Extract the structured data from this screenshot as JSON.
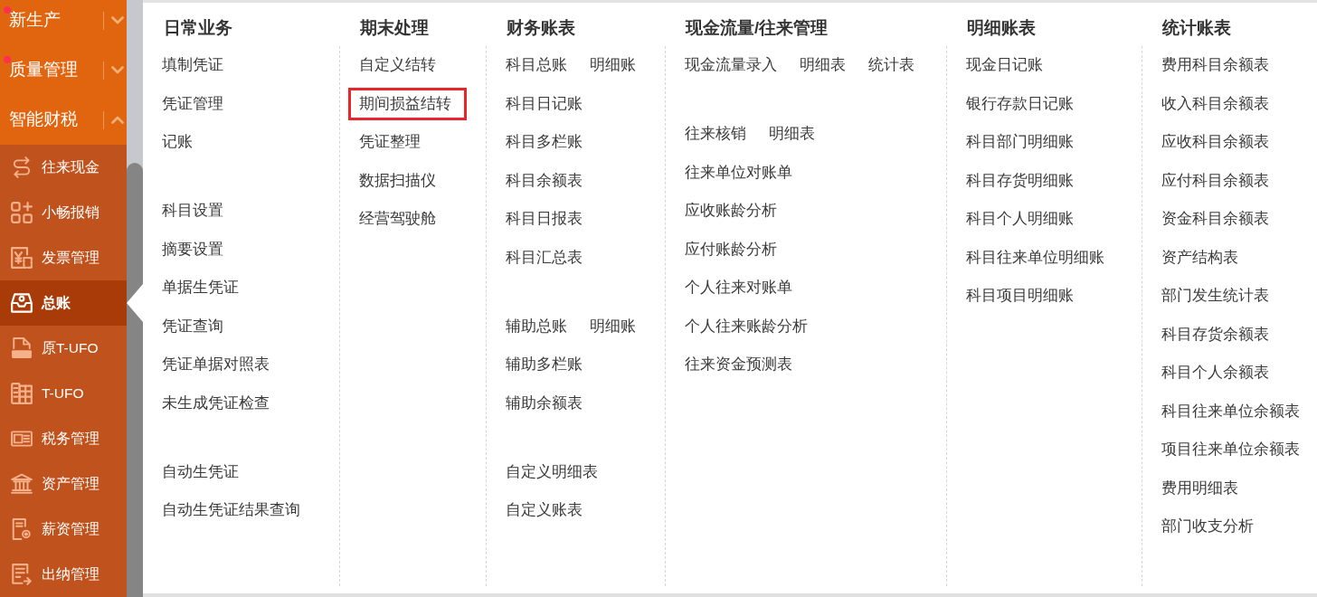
{
  "sidebar": {
    "items": [
      {
        "label": "新生产",
        "expanded": false,
        "has_update": true
      },
      {
        "label": "质量管理",
        "expanded": false,
        "has_update": true
      },
      {
        "label": "智能财税",
        "expanded": true,
        "has_update": false,
        "children": [
          {
            "label": "往来现金",
            "selected": false
          },
          {
            "label": "小畅报销",
            "selected": false
          },
          {
            "label": "发票管理",
            "selected": false
          },
          {
            "label": "总账",
            "selected": true
          },
          {
            "label": "原T-UFO",
            "selected": false
          },
          {
            "label": "T-UFO",
            "selected": false
          },
          {
            "label": "税务管理",
            "selected": false
          },
          {
            "label": "资产管理",
            "selected": false
          },
          {
            "label": "薪资管理",
            "selected": false
          },
          {
            "label": "出纳管理",
            "selected": false
          }
        ]
      }
    ]
  },
  "menu": {
    "columns": [
      {
        "title": "日常业务",
        "groups": [
          [
            [
              {
                "label": "填制凭证",
                "highlighted": false
              }
            ],
            [
              {
                "label": "凭证管理",
                "highlighted": false
              }
            ],
            [
              {
                "label": "记账",
                "highlighted": false
              }
            ]
          ],
          [
            [
              {
                "label": "科目设置",
                "highlighted": false
              }
            ],
            [
              {
                "label": "摘要设置",
                "highlighted": false
              }
            ],
            [
              {
                "label": "单据生凭证",
                "highlighted": false
              }
            ],
            [
              {
                "label": "凭证查询",
                "highlighted": false
              }
            ],
            [
              {
                "label": "凭证单据对照表",
                "highlighted": false
              }
            ],
            [
              {
                "label": "未生成凭证检查",
                "highlighted": false
              }
            ]
          ],
          [
            [
              {
                "label": "自动生凭证",
                "highlighted": false
              }
            ],
            [
              {
                "label": "自动生凭证结果查询",
                "highlighted": false
              }
            ]
          ]
        ]
      },
      {
        "title": "期末处理",
        "groups": [
          [
            [
              {
                "label": "自定义结转",
                "highlighted": false
              }
            ],
            [
              {
                "label": "期间损益结转",
                "highlighted": true
              }
            ],
            [
              {
                "label": "凭证整理",
                "highlighted": false
              }
            ],
            [
              {
                "label": "数据扫描仪",
                "highlighted": false
              }
            ],
            [
              {
                "label": "经营驾驶舱",
                "highlighted": false
              }
            ]
          ]
        ]
      },
      {
        "title": "财务账表",
        "groups": [
          [
            [
              {
                "label": "科目总账",
                "highlighted": false
              },
              {
                "label": "明细账",
                "highlighted": false
              }
            ],
            [
              {
                "label": "科目日记账",
                "highlighted": false
              }
            ],
            [
              {
                "label": "科目多栏账",
                "highlighted": false
              }
            ],
            [
              {
                "label": "科目余额表",
                "highlighted": false
              }
            ],
            [
              {
                "label": "科目日报表",
                "highlighted": false
              }
            ],
            [
              {
                "label": "科目汇总表",
                "highlighted": false
              }
            ]
          ],
          [
            [
              {
                "label": "辅助总账",
                "highlighted": false
              },
              {
                "label": "明细账",
                "highlighted": false
              }
            ],
            [
              {
                "label": "辅助多栏账",
                "highlighted": false
              }
            ],
            [
              {
                "label": "辅助余额表",
                "highlighted": false
              }
            ]
          ],
          [
            [
              {
                "label": "自定义明细表",
                "highlighted": false
              }
            ],
            [
              {
                "label": "自定义账表",
                "highlighted": false
              }
            ]
          ]
        ]
      },
      {
        "title": "现金流量/往来管理",
        "groups": [
          [
            [
              {
                "label": "现金流量录入",
                "highlighted": false
              },
              {
                "label": "明细表",
                "highlighted": false
              },
              {
                "label": "统计表",
                "highlighted": false
              }
            ]
          ],
          [
            [
              {
                "label": "往来核销",
                "highlighted": false
              },
              {
                "label": "明细表",
                "highlighted": false
              }
            ],
            [
              {
                "label": "往来单位对账单",
                "highlighted": false
              }
            ],
            [
              {
                "label": "应收账龄分析",
                "highlighted": false
              }
            ],
            [
              {
                "label": "应付账龄分析",
                "highlighted": false
              }
            ],
            [
              {
                "label": "个人往来对账单",
                "highlighted": false
              }
            ],
            [
              {
                "label": "个人往来账龄分析",
                "highlighted": false
              }
            ],
            [
              {
                "label": "往来资金预测表",
                "highlighted": false
              }
            ]
          ]
        ]
      },
      {
        "title": "明细账表",
        "groups": [
          [
            [
              {
                "label": "现金日记账",
                "highlighted": false
              }
            ],
            [
              {
                "label": "银行存款日记账",
                "highlighted": false
              }
            ],
            [
              {
                "label": "科目部门明细账",
                "highlighted": false
              }
            ],
            [
              {
                "label": "科目存货明细账",
                "highlighted": false
              }
            ],
            [
              {
                "label": "科目个人明细账",
                "highlighted": false
              }
            ],
            [
              {
                "label": "科目往来单位明细账",
                "highlighted": false
              }
            ],
            [
              {
                "label": "科目项目明细账",
                "highlighted": false
              }
            ]
          ]
        ]
      },
      {
        "title": "统计账表",
        "groups": [
          [
            [
              {
                "label": "费用科目余额表",
                "highlighted": false
              }
            ],
            [
              {
                "label": "收入科目余额表",
                "highlighted": false
              }
            ],
            [
              {
                "label": "应收科目余额表",
                "highlighted": false
              }
            ],
            [
              {
                "label": "应付科目余额表",
                "highlighted": false
              }
            ],
            [
              {
                "label": "资金科目余额表",
                "highlighted": false
              }
            ],
            [
              {
                "label": "资产结构表",
                "highlighted": false
              }
            ],
            [
              {
                "label": "部门发生统计表",
                "highlighted": false
              }
            ],
            [
              {
                "label": "科目存货余额表",
                "highlighted": false
              }
            ],
            [
              {
                "label": "科目个人余额表",
                "highlighted": false
              }
            ],
            [
              {
                "label": "科目往来单位余额表",
                "highlighted": false
              }
            ],
            [
              {
                "label": "项目往来单位余额表",
                "highlighted": false
              }
            ],
            [
              {
                "label": "费用明细表",
                "highlighted": false
              }
            ],
            [
              {
                "label": "部门收支分析",
                "highlighted": false
              }
            ]
          ]
        ]
      }
    ]
  }
}
